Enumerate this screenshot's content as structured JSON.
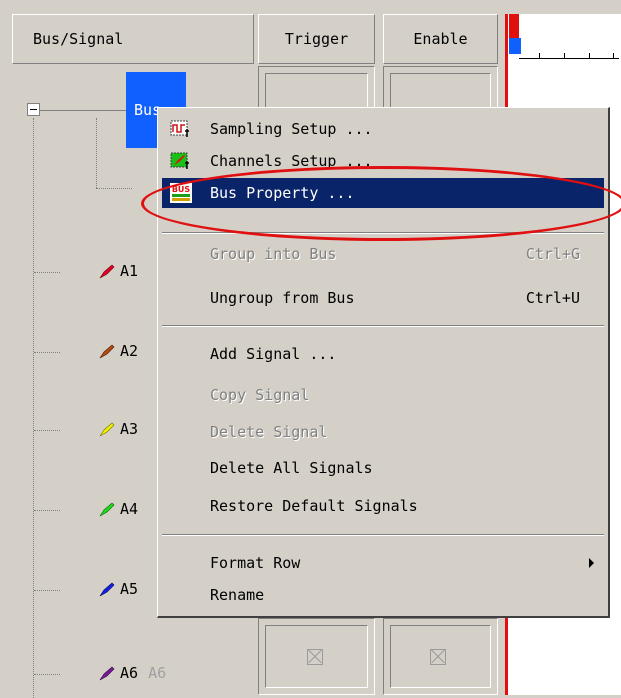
{
  "headers": {
    "bus_signal": "Bus/Signal",
    "trigger": "Trigger",
    "enable": "Enable"
  },
  "bus": {
    "label": "Bus"
  },
  "signals": [
    {
      "name": "A1",
      "color": "#e8002a"
    },
    {
      "name": "A2",
      "color": "#b84a14"
    },
    {
      "name": "A3",
      "color": "#f0f000"
    },
    {
      "name": "A4",
      "color": "#18e018"
    },
    {
      "name": "A5",
      "color": "#1020e8"
    },
    {
      "name": "A6",
      "color": "#7a1a98",
      "alias": "A6"
    }
  ],
  "menu": {
    "sampling_setup": "Sampling Setup ...",
    "channels_setup": "Channels Setup ...",
    "bus_property": "Bus Property ...",
    "bus_icon_text": "BUS",
    "group_into_bus": "Group into Bus",
    "group_into_bus_shortcut": "Ctrl+G",
    "ungroup_from_bus": "Ungroup from Bus",
    "ungroup_from_bus_shortcut": "Ctrl+U",
    "add_signal": "Add Signal ...",
    "copy_signal": "Copy Signal",
    "delete_signal": "Delete Signal",
    "delete_all_signals": "Delete All Signals",
    "restore_default_signals": "Restore Default Signals",
    "format_row": "Format Row",
    "rename": "Rename"
  },
  "colors": {
    "selection": "#0a246a",
    "highlight_ellipse": "#e01010",
    "bus_selected": "#1060ff"
  }
}
